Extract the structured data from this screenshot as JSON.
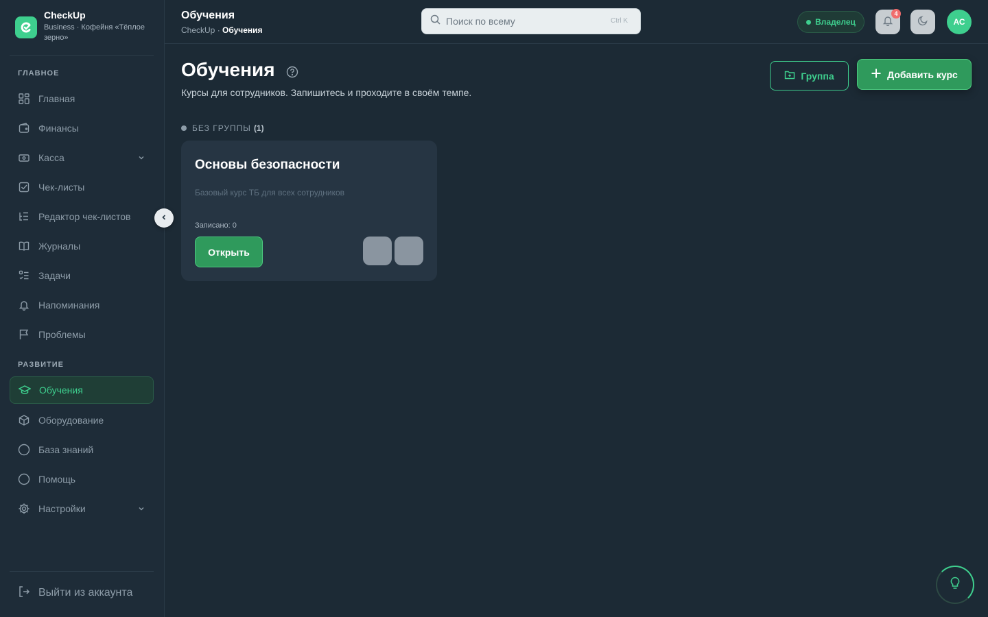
{
  "app": {
    "name": "CheckUp",
    "subtitle": "Business · Кофейня «Тёплое зерно»",
    "accent_color": "#3ecf8e"
  },
  "sidebar": {
    "sections": [
      {
        "title": "ГЛАВНОЕ",
        "items": [
          {
            "label": "Главная",
            "icon": "grid-icon"
          },
          {
            "label": "Финансы",
            "icon": "wallet-icon"
          },
          {
            "label": "Касса",
            "icon": "cash-register-icon",
            "expandable": true
          },
          {
            "label": "Чек-листы",
            "icon": "checkbox-icon"
          },
          {
            "label": "Редактор чек-листов",
            "icon": "list-tree-icon"
          },
          {
            "label": "Журналы",
            "icon": "book-icon"
          },
          {
            "label": "Задачи",
            "icon": "task-list-icon"
          },
          {
            "label": "Напоминания",
            "icon": "bell-icon"
          },
          {
            "label": "Проблемы",
            "icon": "flag-icon"
          }
        ]
      },
      {
        "title": "РАЗВИТИЕ",
        "items": [
          {
            "label": "Обучения",
            "icon": "graduation-cap-icon",
            "active": true
          },
          {
            "label": "Оборудование",
            "icon": "box-icon"
          },
          {
            "label": "База знаний",
            "icon": "circle-icon"
          },
          {
            "label": "Помощь",
            "icon": "circle-icon"
          },
          {
            "label": "Настройки",
            "icon": "gear-icon",
            "expandable": true
          }
        ]
      }
    ],
    "logout_label": "Выйти из аккаунта"
  },
  "topbar": {
    "title": "Обучения",
    "breadcrumb_root": "CheckUp",
    "breadcrumb_sep": " · ",
    "breadcrumb_current": "Обучения",
    "search_placeholder": "Поиск по всему",
    "search_shortcut": "Ctrl K",
    "role_label": "Владелец",
    "notifications_count": "4",
    "avatar_initials": "АС"
  },
  "page": {
    "title": "Обучения",
    "subtitle": "Курсы для сотрудников. Запишитесь и проходите в своём темпе.",
    "group_button": "Группа",
    "add_course_button": "Добавить курс"
  },
  "groups": [
    {
      "label": "БЕЗ ГРУППЫ",
      "count": "(1)",
      "courses": [
        {
          "title": "Основы безопасности",
          "description": "Базовый курс ТБ для всех сотрудников",
          "enrolled": "Записано: 0",
          "open_label": "Открыть"
        }
      ]
    }
  ]
}
